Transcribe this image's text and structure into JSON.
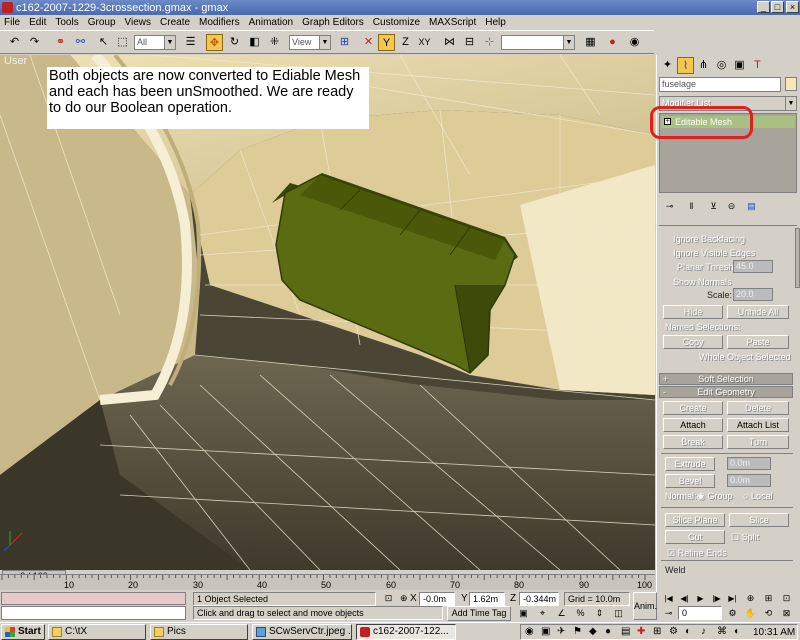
{
  "window": {
    "title": "c162-2007-1229-3crossection.gmax - gmax",
    "minimize": "_",
    "maximize": "□",
    "close": "×"
  },
  "menu": [
    "File",
    "Edit",
    "Tools",
    "Group",
    "Views",
    "Create",
    "Modifiers",
    "Animation",
    "Graph Editors",
    "Customize",
    "MAXScript",
    "Help"
  ],
  "toolbar": {
    "selection_filter": "All",
    "coord_system": "View",
    "named_selection": ""
  },
  "viewport": {
    "label": "User",
    "note": "Both objects are now converted to Ediable Mesh and each has been unSmoothed.  We are ready to do our Boolean operation."
  },
  "command_panel": {
    "object_name": "fuselage",
    "modifier_list": "Modifier List",
    "stack_item": "Editable Mesh",
    "ignore_backfacing": "Ignore Backfacing",
    "ignore_visible_edges": "Ignore Visible Edges",
    "planar_thresh_label": "Planar Thresh:",
    "planar_thresh_value": "45.0",
    "show_normals": "Show Normals",
    "scale_label": "Scale:",
    "scale_value": "20.0",
    "hide": "Hide",
    "unhide_all": "Unhide All",
    "named_selections": "Named Selections:",
    "copy": "Copy",
    "paste": "Paste",
    "whole_object_selected": "Whole Object Selected",
    "soft_selection": "Soft Selection",
    "edit_geometry": "Edit Geometry",
    "soft_selection_sign": "+",
    "edit_geometry_sign": "-",
    "create": "Create",
    "delete": "Delete",
    "attach": "Attach",
    "attach_list": "Attach List",
    "break": "Break",
    "turn": "Turn",
    "extrude": "Extrude",
    "extrude_value": "0.0m",
    "bevel": "Bevel",
    "bevel_value": "0.0m",
    "normal_label": "Normal:",
    "group": "Group",
    "local": "Local",
    "slice_plane": "Slice Plane",
    "slice": "Slice",
    "cut": "Cut",
    "split": "Split",
    "refine_ends": "Refine Ends",
    "weld": "Weld"
  },
  "timeline": {
    "frame_label": "0 / 100",
    "ticks": [
      "10",
      "20",
      "30",
      "40",
      "50",
      "60",
      "70",
      "80",
      "90",
      "100"
    ]
  },
  "status": {
    "selection": "1 Object Selected",
    "prompt": "Click and drag to select and move objects",
    "x_label": "X",
    "x_value": "-0.0m",
    "y_label": "Y",
    "y_value": "1.62m",
    "z_label": "Z",
    "z_value": "-0.344m",
    "grid": "Grid = 10.0m",
    "add_time_tag": "Add Time Tag",
    "anim": "Anim.",
    "frame_value": "0"
  },
  "taskbar": {
    "start": "Start",
    "items": [
      "C:\\tX",
      "Pics",
      "SCwServCtr.jpeg ...",
      "c162-2007-122..."
    ],
    "clock": "10:31 AM"
  },
  "colors": {
    "title_bar": "#4a6ab0",
    "mesh_green": "#5a6b12",
    "viewport_bg": "#5a5443",
    "highlight_red": "#e02020",
    "stack_green": "#a8c080"
  }
}
